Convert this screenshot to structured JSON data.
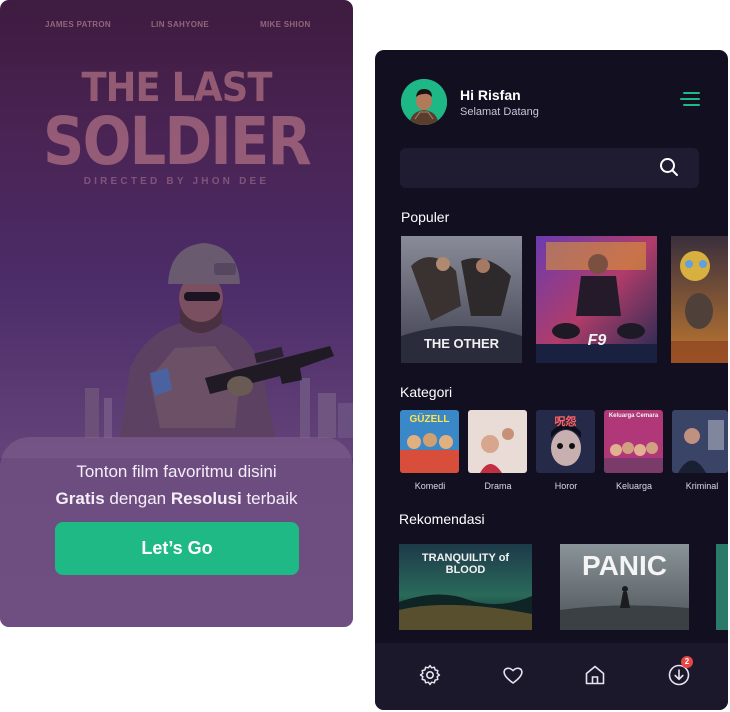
{
  "splash": {
    "credits": [
      "JAMES PATRON",
      "LIN SAHYONE",
      "MIKE SHION"
    ],
    "title_line1": "THE LAST",
    "title_line2": "SOLDIER",
    "directed_by": "DIRECTED BY JHON DEE",
    "tagline_line1": "Tonton film favoritmu disini",
    "tagline_bold1": "Gratis",
    "tagline_mid": " dengan ",
    "tagline_bold2": "Resolusi",
    "tagline_end": " terbaik",
    "cta_label": "Let’s Go"
  },
  "home": {
    "greeting": "Hi Risfan",
    "subtitle": "Selamat Datang",
    "search_placeholder": "",
    "sections": {
      "populer": "Populer",
      "kategori": "Kategori",
      "rekomendasi": "Rekomendasi"
    },
    "popular": [
      {
        "title": "THE OTHER"
      },
      {
        "title": "F9"
      },
      {
        "title": ""
      }
    ],
    "categories": [
      {
        "label": "Komedi",
        "poster_text": "GÜZELL"
      },
      {
        "label": "Drama",
        "poster_text": ""
      },
      {
        "label": "Horor",
        "poster_text": "呪怨"
      },
      {
        "label": "Keluarga",
        "poster_text": "Keluarga Cemara"
      },
      {
        "label": "Kriminal",
        "poster_text": ""
      }
    ],
    "recommended": [
      {
        "title": "TRANQUILITY of BLOOD"
      },
      {
        "title": "PANIC"
      }
    ],
    "notification_count": "2"
  },
  "colors": {
    "accent": "#1fb985",
    "dark_bg": "#120f21",
    "badge": "#e84545"
  }
}
